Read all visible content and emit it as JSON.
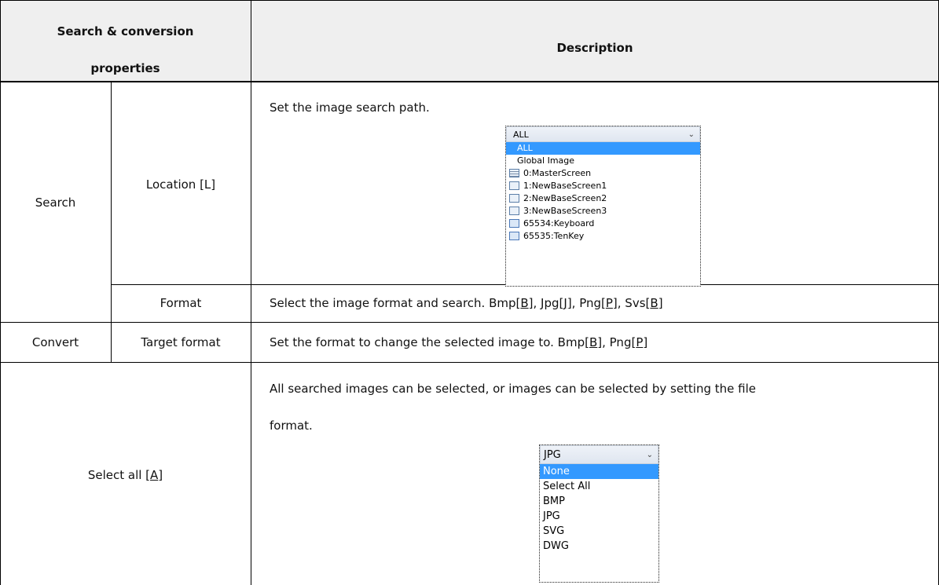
{
  "header": {
    "col1_line1": "Search & conversion",
    "col1_line2": "properties",
    "col2": "Description"
  },
  "rows": {
    "search": {
      "group": "Search",
      "location": {
        "label": "Location [L]",
        "description": "Set the image search path.",
        "dropdown": {
          "selected": "ALL",
          "options": [
            "ALL",
            "Global Image",
            "0:MasterScreen",
            "1:NewBaseScreen1",
            "2:NewBaseScreen2",
            "3:NewBaseScreen3",
            "65534:Keyboard",
            "65535:TenKey"
          ]
        }
      },
      "format": {
        "label": "Format",
        "desc_prefix": "Select the image format and search. Bmp[",
        "k1": "B",
        "s1": "], Jpg[",
        "k2": "J",
        "s2": "], Png[",
        "k3": "P",
        "s3": "], Svs[",
        "k4": "B",
        "s4": "]"
      }
    },
    "convert": {
      "group": "Convert",
      "label": "Target format",
      "desc_prefix": "Set the format to change the selected image to. Bmp[",
      "k1": "B",
      "s1": "], Png[",
      "k2": "P",
      "s2": "]"
    },
    "select_all": {
      "label_prefix": "Select all [",
      "key": "A",
      "label_suffix": "]",
      "desc_line1": "All searched images can be selected, or images can be selected by setting the file",
      "desc_line2": "format.",
      "dropdown": {
        "selected": "JPG",
        "options": [
          "None",
          "Select All",
          "BMP",
          "JPG",
          "SVG",
          "DWG"
        ]
      }
    }
  },
  "colors": {
    "header_bg": "#efefef",
    "highlight": "#3399ff",
    "border": "#000000"
  }
}
